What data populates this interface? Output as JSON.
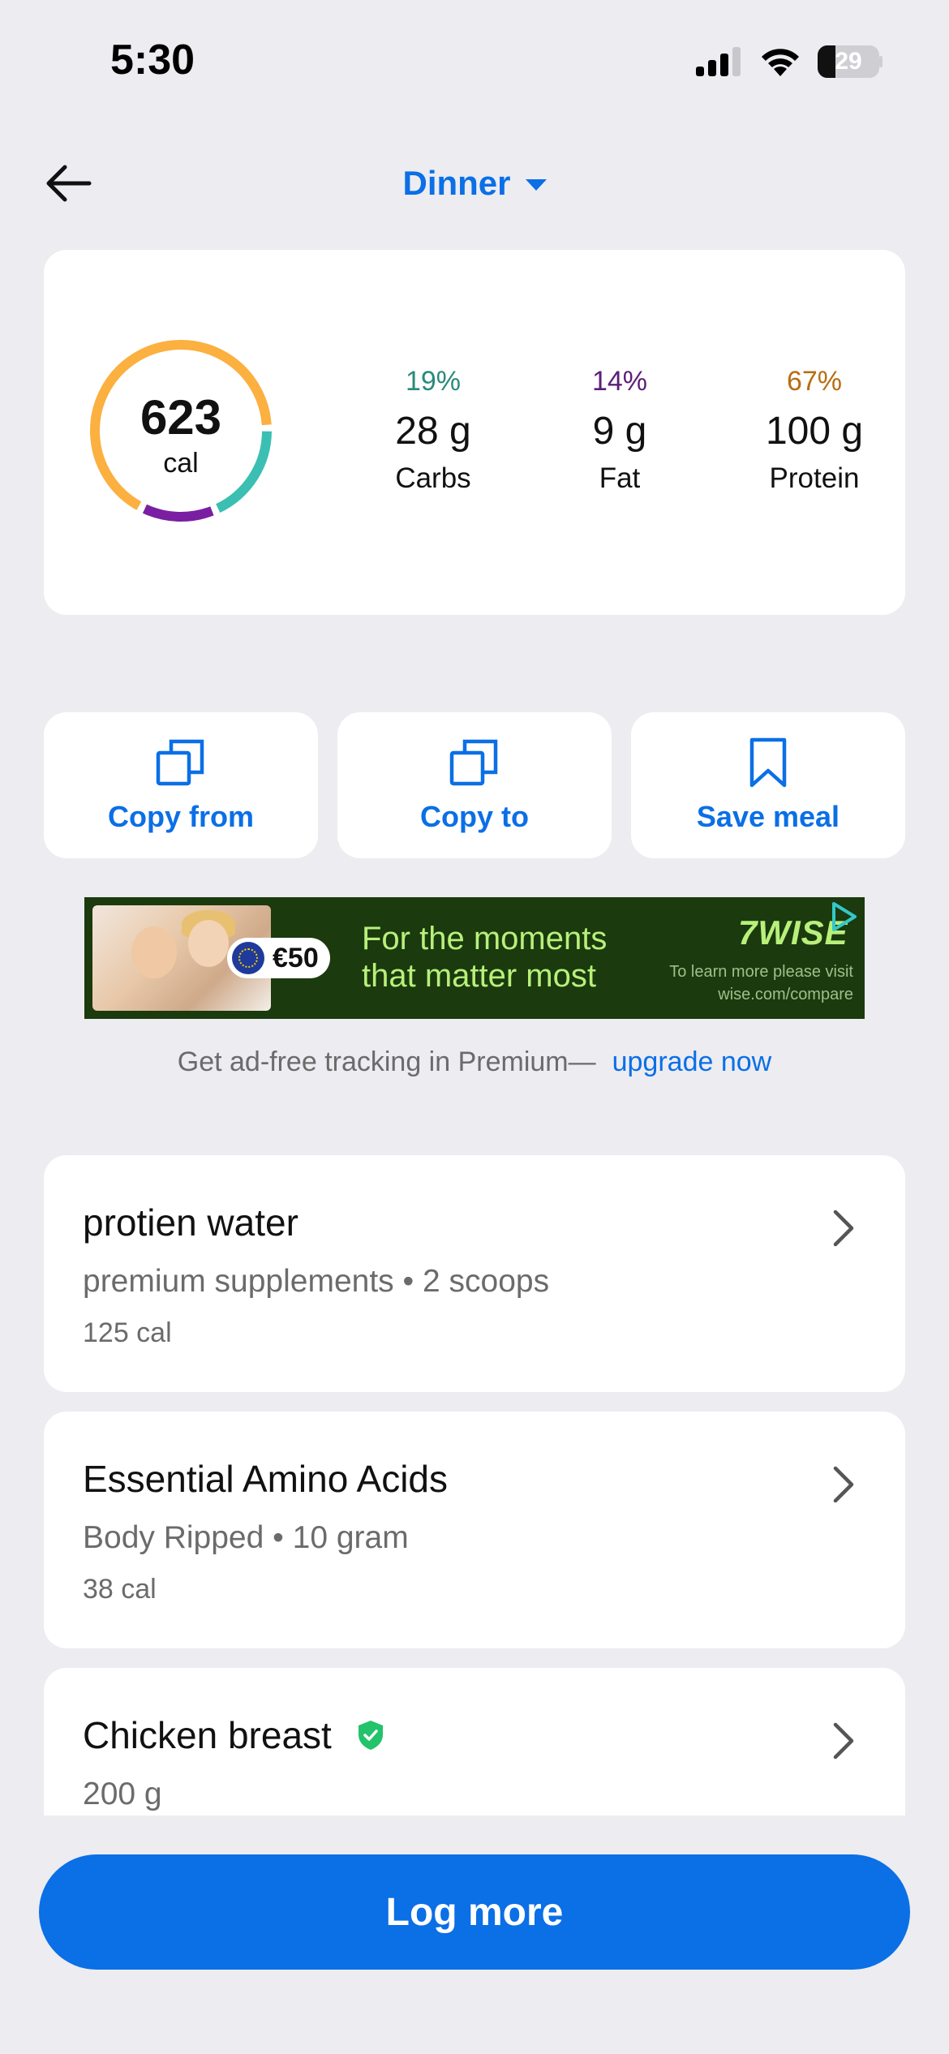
{
  "status_bar": {
    "time": "5:30",
    "battery": "29",
    "battery_level": 0.29
  },
  "header": {
    "meal": "Dinner"
  },
  "summary": {
    "calories": "623",
    "calories_unit": "cal",
    "ring_segments": [
      {
        "macro": "Carbs",
        "fraction": 0.19,
        "color": "#3bbfb3"
      },
      {
        "macro": "Fat",
        "fraction": 0.14,
        "color": "#7a1fa2"
      },
      {
        "macro": "Protein",
        "fraction": 0.67,
        "color": "#fbb040"
      }
    ],
    "macros": [
      {
        "pct": "19%",
        "value": "28 g",
        "name": "Carbs",
        "color": "#2a8a7d"
      },
      {
        "pct": "14%",
        "value": "9 g",
        "name": "Fat",
        "color": "#5d1e7a"
      },
      {
        "pct": "67%",
        "value": "100 g",
        "name": "Protein",
        "color": "#b86d12"
      }
    ]
  },
  "actions": [
    {
      "label": "Copy from",
      "icon": "copy-icon"
    },
    {
      "label": "Copy to",
      "icon": "copy-icon"
    },
    {
      "label": "Save meal",
      "icon": "bookmark-icon"
    }
  ],
  "ad": {
    "badge": "€50",
    "headline_line1": "For the moments",
    "headline_line2": "that matter most",
    "logo": "7WISE",
    "small_line1": "To learn more please visit",
    "small_line2": "wise.com/compare"
  },
  "premium": {
    "text": "Get ad-free tracking in Premium—",
    "link": "upgrade now"
  },
  "foods": [
    {
      "name": "protien water",
      "meta": "premium supplements • 2 scoops",
      "cal": "125 cal",
      "verified": false
    },
    {
      "name": "Essential Amino Acids",
      "meta": "Body  Ripped • 10 gram",
      "cal": "38 cal",
      "verified": false
    },
    {
      "name": "Chicken breast",
      "meta": "200 g",
      "cal": "",
      "verified": true
    }
  ],
  "log_button": "Log more",
  "colors": {
    "accent": "#0b6fe6",
    "background": "#ececf1",
    "verified": "#22c36b"
  }
}
